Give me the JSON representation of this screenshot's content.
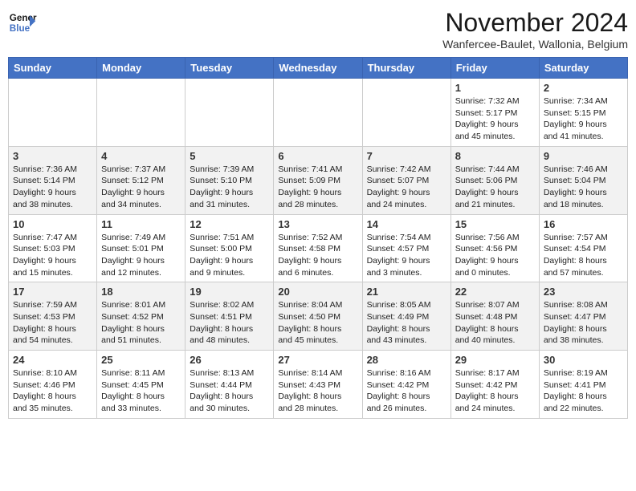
{
  "header": {
    "logo_line1": "General",
    "logo_line2": "Blue",
    "month": "November 2024",
    "location": "Wanfercee-Baulet, Wallonia, Belgium"
  },
  "weekdays": [
    "Sunday",
    "Monday",
    "Tuesday",
    "Wednesday",
    "Thursday",
    "Friday",
    "Saturday"
  ],
  "weeks": [
    [
      {
        "day": "",
        "info": ""
      },
      {
        "day": "",
        "info": ""
      },
      {
        "day": "",
        "info": ""
      },
      {
        "day": "",
        "info": ""
      },
      {
        "day": "",
        "info": ""
      },
      {
        "day": "1",
        "info": "Sunrise: 7:32 AM\nSunset: 5:17 PM\nDaylight: 9 hours\nand 45 minutes."
      },
      {
        "day": "2",
        "info": "Sunrise: 7:34 AM\nSunset: 5:15 PM\nDaylight: 9 hours\nand 41 minutes."
      }
    ],
    [
      {
        "day": "3",
        "info": "Sunrise: 7:36 AM\nSunset: 5:14 PM\nDaylight: 9 hours\nand 38 minutes."
      },
      {
        "day": "4",
        "info": "Sunrise: 7:37 AM\nSunset: 5:12 PM\nDaylight: 9 hours\nand 34 minutes."
      },
      {
        "day": "5",
        "info": "Sunrise: 7:39 AM\nSunset: 5:10 PM\nDaylight: 9 hours\nand 31 minutes."
      },
      {
        "day": "6",
        "info": "Sunrise: 7:41 AM\nSunset: 5:09 PM\nDaylight: 9 hours\nand 28 minutes."
      },
      {
        "day": "7",
        "info": "Sunrise: 7:42 AM\nSunset: 5:07 PM\nDaylight: 9 hours\nand 24 minutes."
      },
      {
        "day": "8",
        "info": "Sunrise: 7:44 AM\nSunset: 5:06 PM\nDaylight: 9 hours\nand 21 minutes."
      },
      {
        "day": "9",
        "info": "Sunrise: 7:46 AM\nSunset: 5:04 PM\nDaylight: 9 hours\nand 18 minutes."
      }
    ],
    [
      {
        "day": "10",
        "info": "Sunrise: 7:47 AM\nSunset: 5:03 PM\nDaylight: 9 hours\nand 15 minutes."
      },
      {
        "day": "11",
        "info": "Sunrise: 7:49 AM\nSunset: 5:01 PM\nDaylight: 9 hours\nand 12 minutes."
      },
      {
        "day": "12",
        "info": "Sunrise: 7:51 AM\nSunset: 5:00 PM\nDaylight: 9 hours\nand 9 minutes."
      },
      {
        "day": "13",
        "info": "Sunrise: 7:52 AM\nSunset: 4:58 PM\nDaylight: 9 hours\nand 6 minutes."
      },
      {
        "day": "14",
        "info": "Sunrise: 7:54 AM\nSunset: 4:57 PM\nDaylight: 9 hours\nand 3 minutes."
      },
      {
        "day": "15",
        "info": "Sunrise: 7:56 AM\nSunset: 4:56 PM\nDaylight: 9 hours\nand 0 minutes."
      },
      {
        "day": "16",
        "info": "Sunrise: 7:57 AM\nSunset: 4:54 PM\nDaylight: 8 hours\nand 57 minutes."
      }
    ],
    [
      {
        "day": "17",
        "info": "Sunrise: 7:59 AM\nSunset: 4:53 PM\nDaylight: 8 hours\nand 54 minutes."
      },
      {
        "day": "18",
        "info": "Sunrise: 8:01 AM\nSunset: 4:52 PM\nDaylight: 8 hours\nand 51 minutes."
      },
      {
        "day": "19",
        "info": "Sunrise: 8:02 AM\nSunset: 4:51 PM\nDaylight: 8 hours\nand 48 minutes."
      },
      {
        "day": "20",
        "info": "Sunrise: 8:04 AM\nSunset: 4:50 PM\nDaylight: 8 hours\nand 45 minutes."
      },
      {
        "day": "21",
        "info": "Sunrise: 8:05 AM\nSunset: 4:49 PM\nDaylight: 8 hours\nand 43 minutes."
      },
      {
        "day": "22",
        "info": "Sunrise: 8:07 AM\nSunset: 4:48 PM\nDaylight: 8 hours\nand 40 minutes."
      },
      {
        "day": "23",
        "info": "Sunrise: 8:08 AM\nSunset: 4:47 PM\nDaylight: 8 hours\nand 38 minutes."
      }
    ],
    [
      {
        "day": "24",
        "info": "Sunrise: 8:10 AM\nSunset: 4:46 PM\nDaylight: 8 hours\nand 35 minutes."
      },
      {
        "day": "25",
        "info": "Sunrise: 8:11 AM\nSunset: 4:45 PM\nDaylight: 8 hours\nand 33 minutes."
      },
      {
        "day": "26",
        "info": "Sunrise: 8:13 AM\nSunset: 4:44 PM\nDaylight: 8 hours\nand 30 minutes."
      },
      {
        "day": "27",
        "info": "Sunrise: 8:14 AM\nSunset: 4:43 PM\nDaylight: 8 hours\nand 28 minutes."
      },
      {
        "day": "28",
        "info": "Sunrise: 8:16 AM\nSunset: 4:42 PM\nDaylight: 8 hours\nand 26 minutes."
      },
      {
        "day": "29",
        "info": "Sunrise: 8:17 AM\nSunset: 4:42 PM\nDaylight: 8 hours\nand 24 minutes."
      },
      {
        "day": "30",
        "info": "Sunrise: 8:19 AM\nSunset: 4:41 PM\nDaylight: 8 hours\nand 22 minutes."
      }
    ]
  ]
}
